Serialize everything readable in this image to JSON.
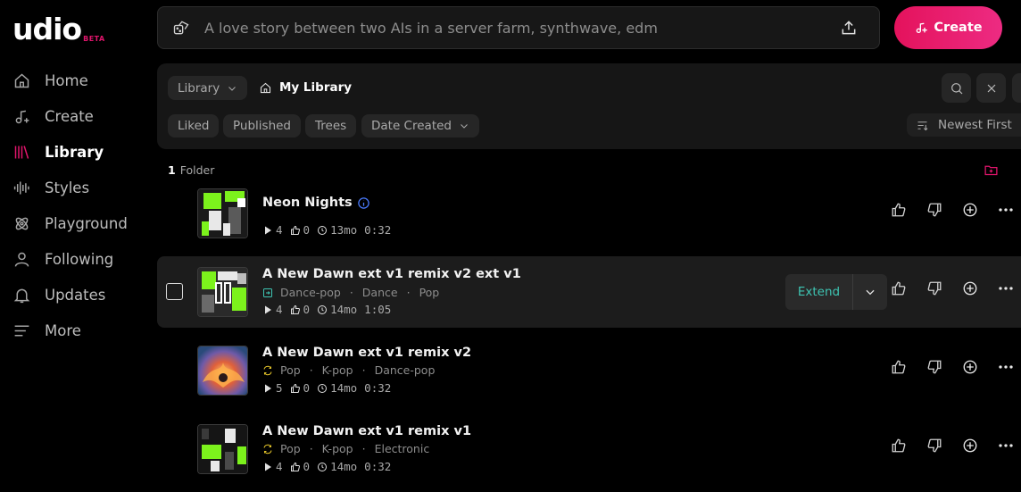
{
  "app": {
    "logo_text": "udio",
    "logo_badge": "BETA",
    "accent": "#e1156c"
  },
  "sidebar": {
    "items": [
      {
        "label": "Home",
        "icon": "home-icon"
      },
      {
        "label": "Create",
        "icon": "music-plus-icon"
      },
      {
        "label": "Library",
        "icon": "library-icon",
        "active": true
      },
      {
        "label": "Styles",
        "icon": "waveform-icon"
      },
      {
        "label": "Playground",
        "icon": "atom-icon"
      },
      {
        "label": "Following",
        "icon": "user-icon"
      },
      {
        "label": "Updates",
        "icon": "bell-icon"
      },
      {
        "label": "More",
        "icon": "menu-icon"
      }
    ]
  },
  "topbar": {
    "prompt_placeholder": "A love story between two AIs in a server farm, synthwave, edm",
    "create_label": "Create"
  },
  "library": {
    "scope_label": "Library",
    "breadcrumb": "My Library",
    "filters": [
      "Liked",
      "Published",
      "Trees",
      "Date Created"
    ],
    "sort_label": "Newest First",
    "folder_count": "1",
    "folder_label": "Folder"
  },
  "songs": [
    {
      "title": "Neon Nights",
      "tags": [],
      "plays": "4",
      "likes": "0",
      "age": "13mo",
      "duration": "0:32"
    },
    {
      "title": "A New Dawn ext v1 remix v2 ext v1",
      "tags": [
        "Dance-pop",
        "Dance",
        "Pop"
      ],
      "plays": "4",
      "likes": "0",
      "age": "14mo",
      "duration": "1:05",
      "hover_action": "Extend"
    },
    {
      "title": "A New Dawn ext v1 remix v2",
      "tags": [
        "Pop",
        "K-pop",
        "Dance-pop"
      ],
      "plays": "5",
      "likes": "0",
      "age": "14mo",
      "duration": "0:32"
    },
    {
      "title": "A New Dawn ext v1 remix v1",
      "tags": [
        "Pop",
        "K-pop",
        "Electronic"
      ],
      "plays": "4",
      "likes": "0",
      "age": "14mo",
      "duration": "0:32"
    }
  ]
}
